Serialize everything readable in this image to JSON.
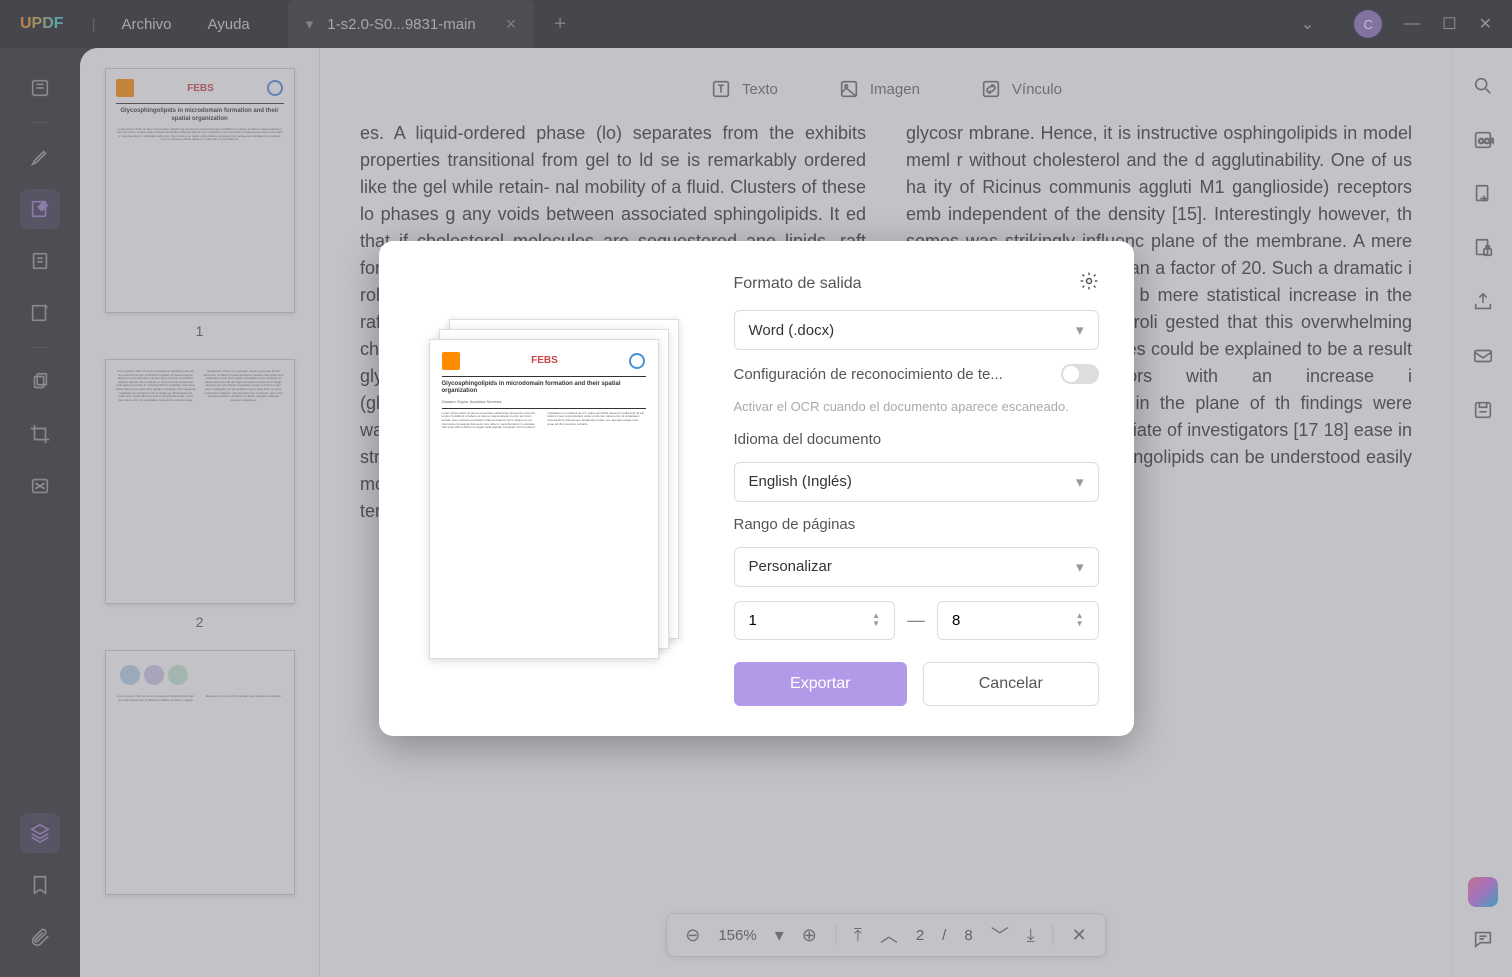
{
  "app": {
    "name": "UPDF",
    "menu_file": "Archivo",
    "menu_help": "Ayuda"
  },
  "tab": {
    "title": "1-s2.0-S0...9831-main"
  },
  "avatar": "C",
  "content_tabs": {
    "text": "Texto",
    "image": "Imagen",
    "link": "Vínculo"
  },
  "thumbs": {
    "p1": "1",
    "p2": "2"
  },
  "modal": {
    "output_format_label": "Formato de salida",
    "format_value": "Word (.docx)",
    "ocr_label": "Configuración de reconocimiento de te...",
    "ocr_hint": "Activar el OCR cuando el documento aparece escaneado.",
    "lang_label": "Idioma del documento",
    "lang_value": "English (Inglés)",
    "range_label": "Rango de páginas",
    "range_value": "Personalizar",
    "range_from": "1",
    "range_to": "8",
    "export": "Exportar",
    "cancel": "Cancelar"
  },
  "zoom": {
    "level": "156%",
    "page_cur": "2",
    "page_sep": "/",
    "page_total": "8"
  },
  "doc_text_left": "es. A liquid-ordered phase (lo) separates from the exhibits properties transitional from gel to ld se is remarkably ordered like the gel while retain- nal mobility of a fluid. Clusters of these lo phases g any voids between associated sphingolipids. It ed that if cholesterol molecules are sequestered ane lipids, raft formation does not take place. It very important and dominant role in raft forma- tion [4-6]. olubility is mainly used to define raft domains bio- ological membran  r-density fraction re cholesterol, sphingomyelin and glycolipid rich,",
  "doc_text_right": "served that glycosphingolipids are capable of i ing domains on membranes (glycosynap participation of cholesterol [11-13]. These don wards intercellular interactions and recogni monstrate varied structures rent acyl chains and head g in structure of the molecules a ehavior in microdomains [11, ne 1970s, before the term \"lip es existed which demonstrat uences clustering of glycosr mbrane. Hence, it is instructive osphingolipids in model meml r without cholesterol and the d agglutinability. One of us ha ity of Ricinus communis aggluti M1 ganglioside) receptors emb independent of the density [15]. Interestingly however, th somes was strikingly influenc plane of the membrane. A mere M1 increased the rate constan a factor of 20. Such a dramatic i ion of the glycosphingolipid b mere statistical increase in the mbrane surface. Hence, Suroli gested that this overwhelming increase in the n of liposomes could be explained to be a result glycosphingolipid receptors with an increase i sphingolipids:phospholipids in the plane of th findings were later on followed and appreciate of investigators [17 18] ease in the den nes with higher sphingolipids can be understood easily by the f"
}
